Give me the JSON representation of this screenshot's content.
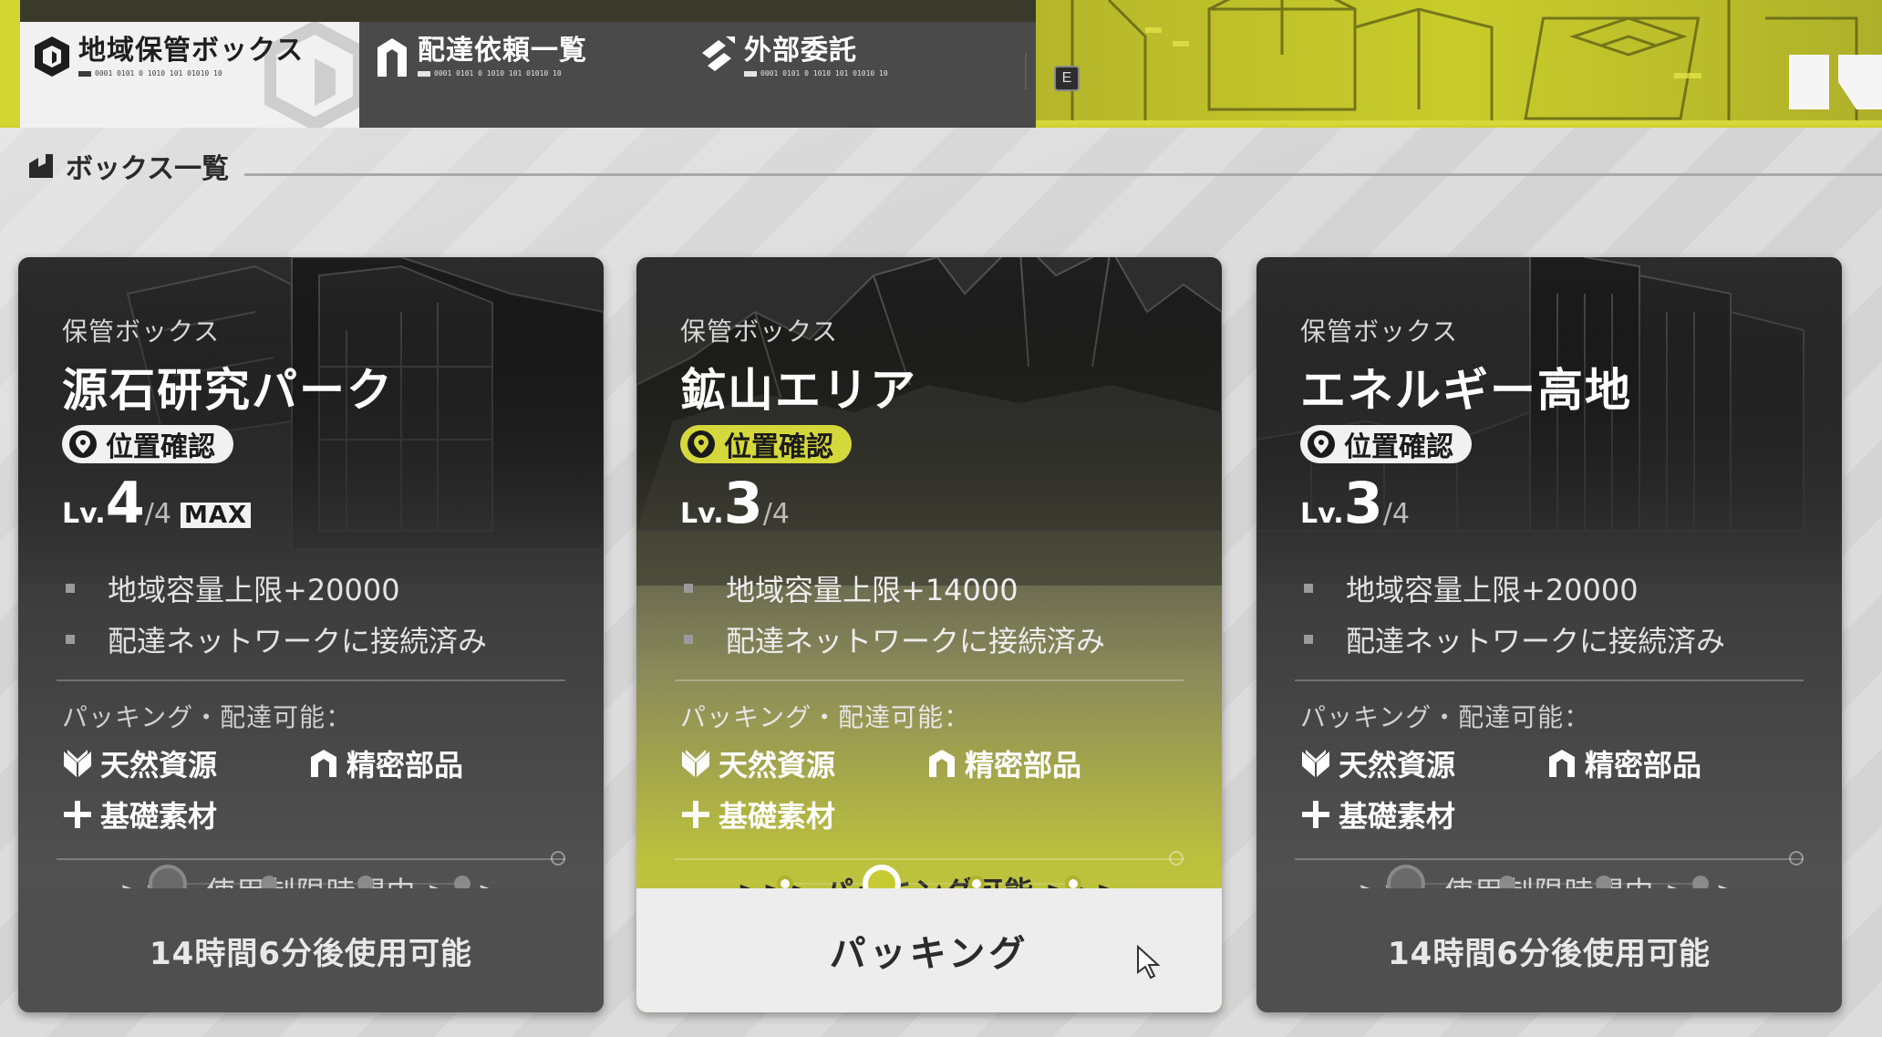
{
  "tabs": [
    {
      "label": "地域保管ボックス",
      "code": "0001 0101 0 1010 101 01010 10",
      "active": true
    },
    {
      "label": "配達依頼一覧",
      "code": "0001 0101 0 1010 101 01010 10",
      "active": false
    },
    {
      "label": "外部委託",
      "code": "0001 0101 0 1010 101 01010 10",
      "active": false
    }
  ],
  "key_hint": "E",
  "section": {
    "title": "ボックス一覧"
  },
  "cards": [
    {
      "subtitle": "保管ボックス",
      "name": "源石研究パーク",
      "location_button": "位置確認",
      "level_prefix": "Lv.",
      "level": "4",
      "level_max": "/4",
      "max_badge": "MAX",
      "bullets": [
        "地域容量上限+20000",
        "配達ネットワークに接続済み"
      ],
      "packing_title": "パッキング・配達可能：",
      "categories": [
        "天然資源",
        "精密部品",
        "基礎素材"
      ],
      "status": ">>> 使用制限時間中 >>>",
      "footer": "14時間6分後使用可能"
    },
    {
      "subtitle": "保管ボックス",
      "name": "鉱山エリア",
      "location_button": "位置確認",
      "level_prefix": "Lv.",
      "level": "3",
      "level_max": "/4",
      "bullets": [
        "地域容量上限+14000",
        "配達ネットワークに接続済み"
      ],
      "packing_title": "パッキング・配達可能：",
      "categories": [
        "天然資源",
        "精密部品",
        "基礎素材"
      ],
      "status": ">>> パッキング可能 >>>",
      "footer": "パッキング"
    },
    {
      "subtitle": "保管ボックス",
      "name": "エネルギー高地",
      "location_button": "位置確認",
      "level_prefix": "Lv.",
      "level": "3",
      "level_max": "/4",
      "bullets": [
        "地域容量上限+20000",
        "配達ネットワークに接続済み"
      ],
      "packing_title": "パッキング・配達可能：",
      "categories": [
        "天然資源",
        "精密部品",
        "基礎素材"
      ],
      "status": ">>> 使用制限時間中 >>>",
      "footer": "14時間6分後使用可能"
    }
  ],
  "colors": {
    "accent": "#d5d83a",
    "card_dark": "#2c2c2c",
    "footer_dark": "#4f4f4f"
  }
}
